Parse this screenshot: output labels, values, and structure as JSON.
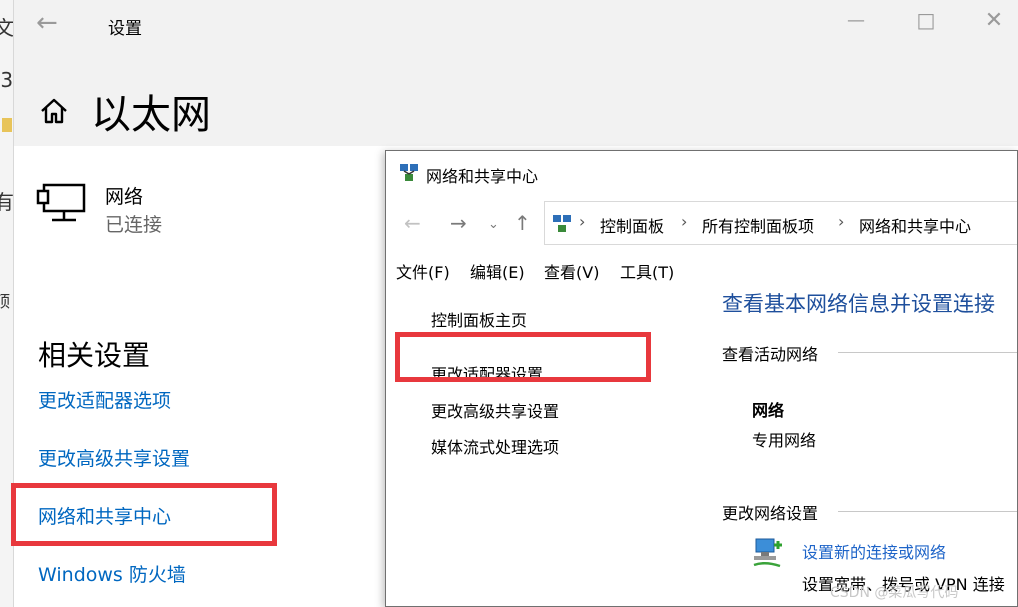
{
  "background": {
    "fragments": [
      "文",
      ".3",
      "有",
      "顶"
    ]
  },
  "settings": {
    "title": "设置",
    "page_title": "以太网",
    "network": {
      "name": "网络",
      "status": "已连接"
    },
    "related_settings": {
      "title": "相关设置",
      "links": [
        "更改适配器选项",
        "更改高级共享设置",
        "网络和共享中心",
        "Windows 防火墙"
      ]
    },
    "accent_color": "#0067c0",
    "highlight_color": "#e8383d"
  },
  "nsc": {
    "title": "网络和共享中心",
    "breadcrumb": [
      "控制面板",
      "所有控制面板项",
      "网络和共享中心"
    ],
    "menu": [
      "文件(F)",
      "编辑(E)",
      "查看(V)",
      "工具(T)"
    ],
    "left_links": [
      "控制面板主页",
      "更改适配器设置",
      "更改高级共享设置",
      "媒体流式处理选项"
    ],
    "main_title": "查看基本网络信息并设置连接",
    "active_section": "查看活动网络",
    "active_network": {
      "name": "网络",
      "type": "专用网络"
    },
    "change_section": "更改网络设置",
    "setup": {
      "link": "设置新的连接或网络",
      "desc": "设置宽带、拨号或 VPN 连接"
    },
    "title_color": "#1e4f9c"
  },
  "watermark": "CSDN @菜瓜写代码"
}
